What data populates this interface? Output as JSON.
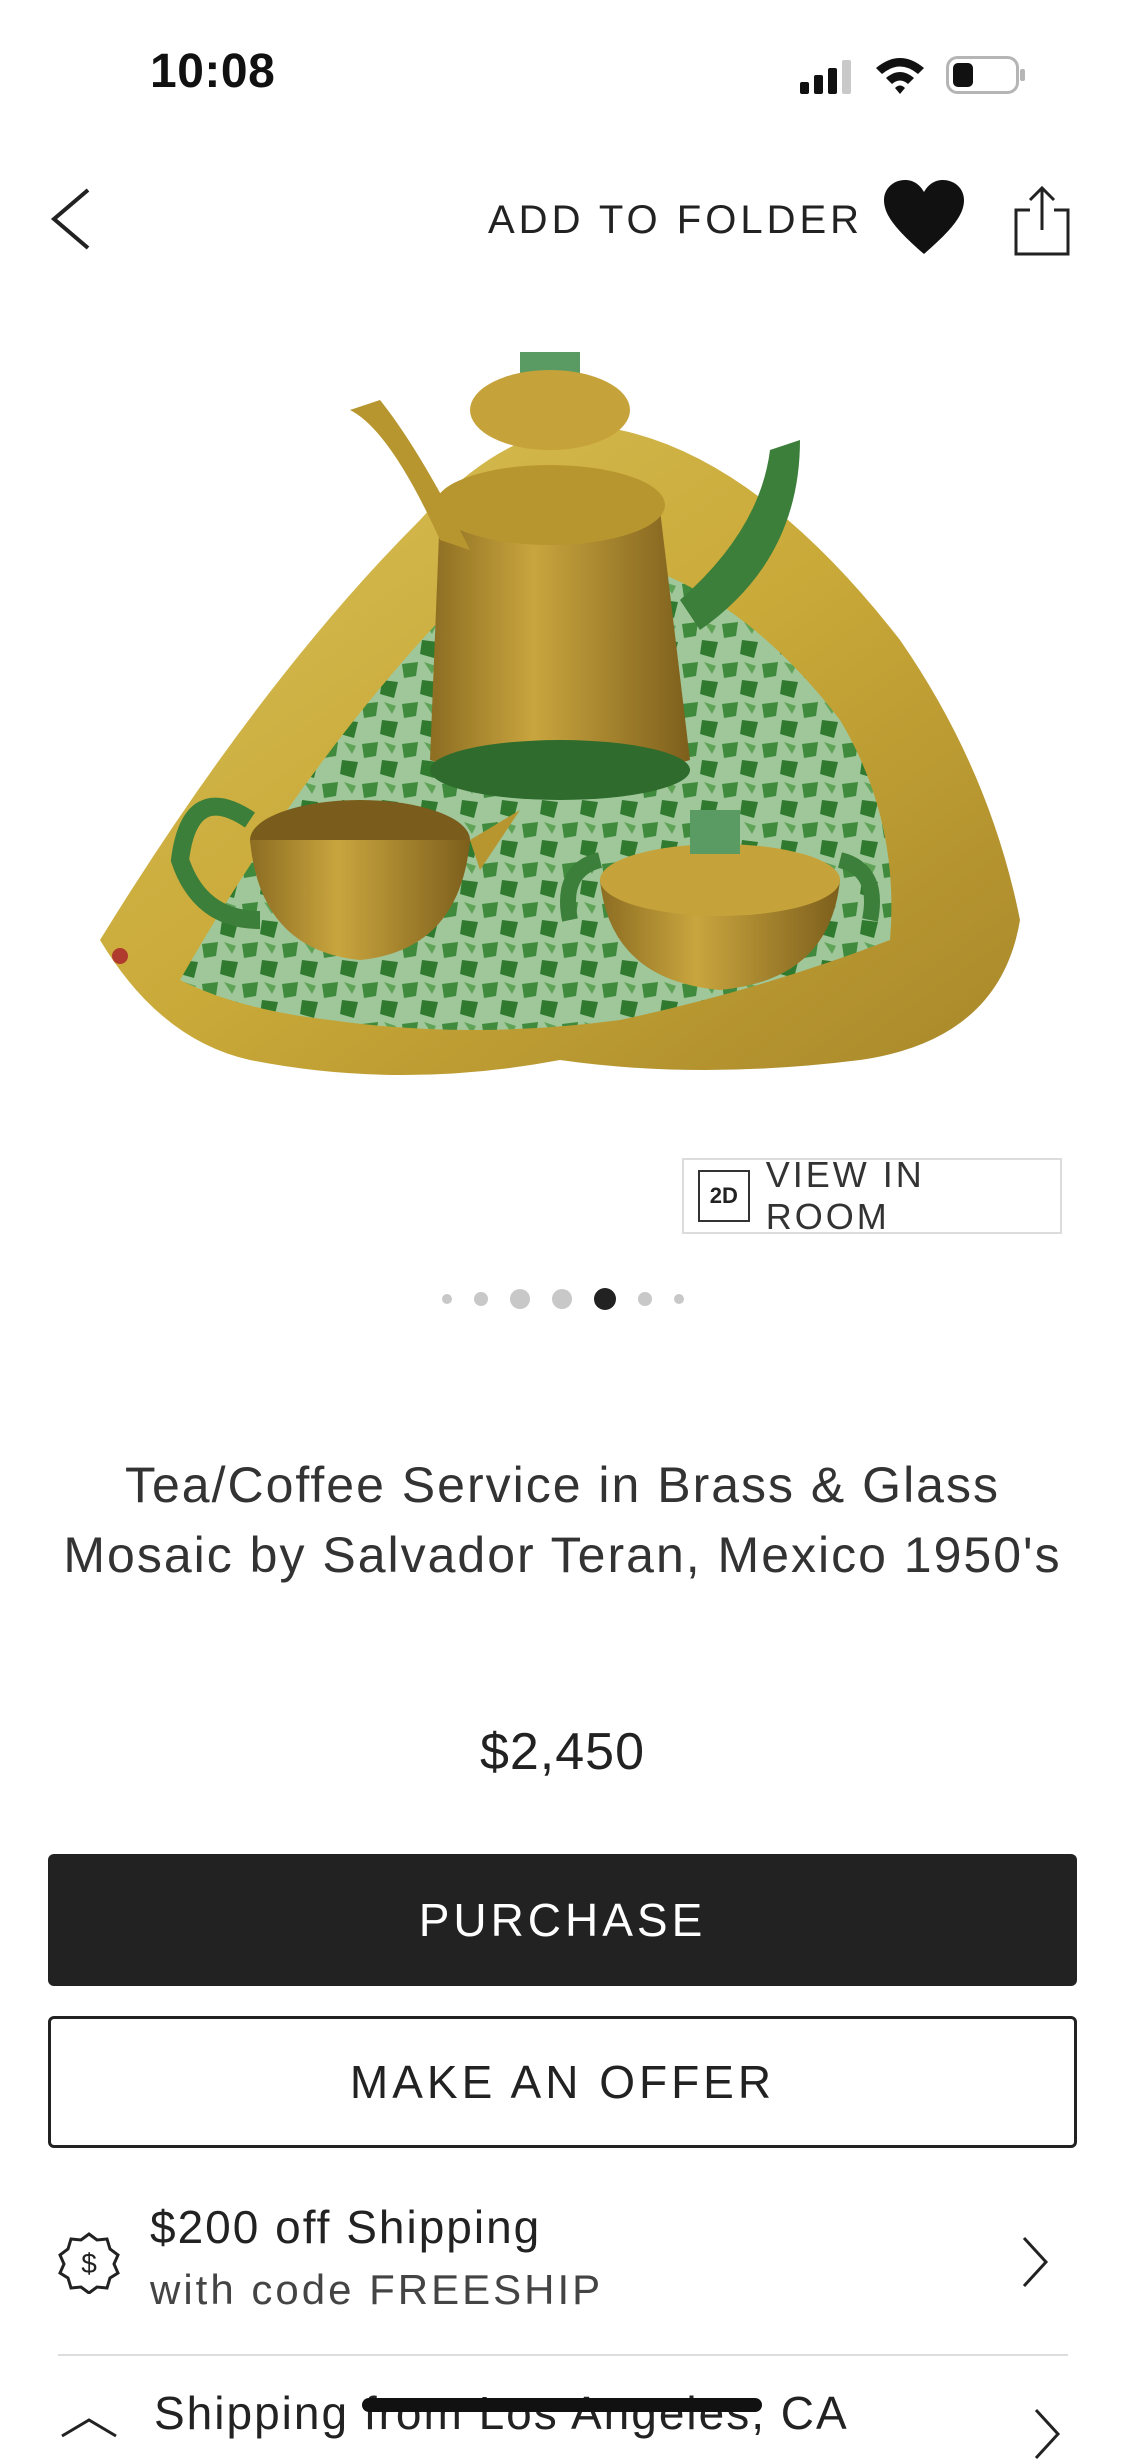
{
  "status_bar": {
    "time": "10:08"
  },
  "nav": {
    "add_to_folder": "ADD TO FOLDER"
  },
  "product": {
    "view_in_room_badge": "2D",
    "view_in_room": "VIEW IN ROOM",
    "title": "Tea/Coffee Service in Brass & Glass Mosaic by Salvador Teran, Mexico 1950's",
    "price": "$2,450",
    "carousel": {
      "count": 7,
      "active_index": 4
    }
  },
  "actions": {
    "purchase": "PURCHASE",
    "make_offer": "MAKE AN OFFER"
  },
  "shipping_promo": {
    "title": "$200 off Shipping",
    "code_line": "with code FREESHIP",
    "icon": "dollar-badge-icon"
  },
  "shipping_origin": {
    "label": "Shipping from Los Angeles, CA"
  }
}
